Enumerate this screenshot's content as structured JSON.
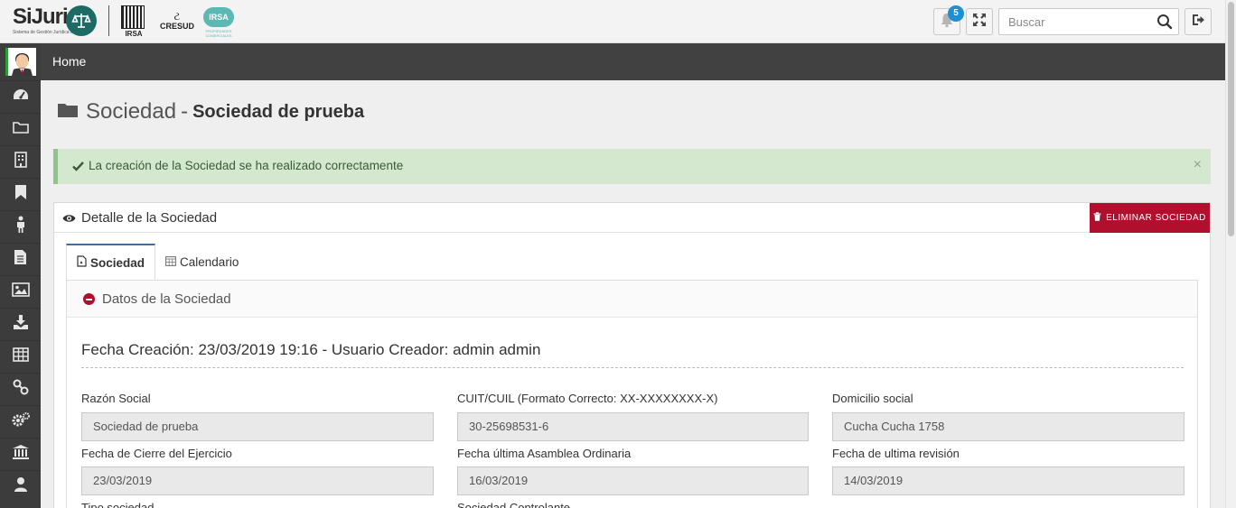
{
  "header": {
    "logo_text": "SiJuri",
    "logo_subtext": "Sistema de Gestión Jurídica Integral",
    "partner_logos": [
      "IRSA",
      "CRESUD",
      "IRSA"
    ],
    "irsa_subtext": "PROPIEDADES COMERCIALES",
    "notifications_count": "5",
    "search_placeholder": "Buscar"
  },
  "breadcrumb": {
    "home": "Home"
  },
  "sidebar": {
    "items": [
      "dashboard-icon",
      "folder-icon",
      "building-icon",
      "bookmark-icon",
      "person-icon",
      "document-icon",
      "image-icon",
      "download-icon",
      "table-icon",
      "link-icon",
      "gears-icon",
      "institution-icon",
      "user-icon"
    ]
  },
  "page": {
    "title": "Sociedad",
    "separator": "-",
    "subtitle": "Sociedad de prueba"
  },
  "alert": {
    "message": "La creación de la Sociedad se ha realizado correctamente",
    "close": "×"
  },
  "panel": {
    "title": "Detalle de la Sociedad",
    "delete_button": "ELIMINAR SOCIEDAD",
    "tabs": [
      {
        "label": "Sociedad"
      },
      {
        "label": "Calendario"
      }
    ],
    "section_title": "Datos de la Sociedad",
    "meta": "Fecha Creación: 23/03/2019 19:16 - Usuario Creador: admin admin",
    "fields": {
      "razon_social": {
        "label": "Razón Social",
        "value": "Sociedad de prueba"
      },
      "cuit": {
        "label": "CUIT/CUIL (Formato Correcto: XX-XXXXXXXX-X)",
        "value": "30-25698531-6"
      },
      "domicilio": {
        "label": "Domicilio social",
        "value": "Cucha Cucha 1758"
      },
      "cierre": {
        "label": "Fecha de Cierre del Ejercicio",
        "value": "23/03/2019"
      },
      "asamblea": {
        "label": "Fecha última Asamblea Ordinaria",
        "value": "16/03/2019"
      },
      "revision": {
        "label": "Fecha de ultima revisión",
        "value": "14/03/2019"
      },
      "tipo": {
        "label": "Tipo sociedad"
      },
      "controlante": {
        "label": "Sociedad Controlante"
      }
    }
  },
  "colors": {
    "accent_red": "#b0102e",
    "sidebar": "#3c3c3c",
    "alert_bg": "#d4e8cf",
    "badge": "#1e8fd5"
  }
}
